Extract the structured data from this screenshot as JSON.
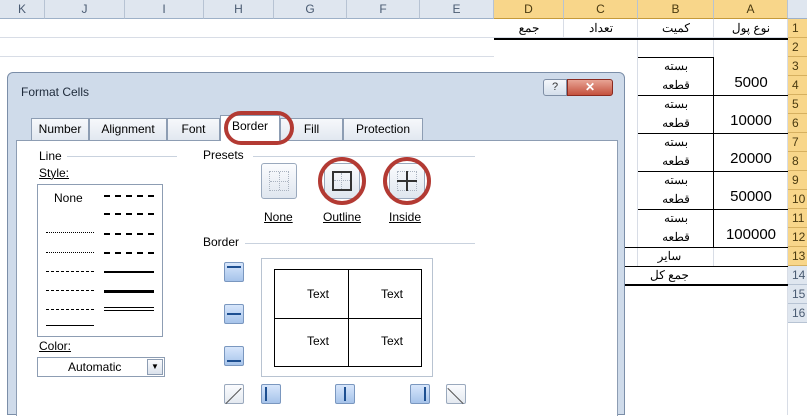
{
  "sheet": {
    "columns": [
      "K",
      "J",
      "I",
      "H",
      "G",
      "F",
      "E",
      "D",
      "C",
      "B",
      "A"
    ],
    "selected_columns": [
      "D",
      "C",
      "B",
      "A"
    ],
    "rows": [
      "1",
      "2",
      "3",
      "4",
      "5",
      "6",
      "7",
      "8",
      "9",
      "10",
      "11",
      "12",
      "13",
      "14",
      "15",
      "16"
    ],
    "selected_rows": [
      "1",
      "2",
      "3",
      "4",
      "5",
      "6",
      "7",
      "8",
      "9",
      "10",
      "11",
      "12",
      "13"
    ],
    "header_row": {
      "a": "نوع پول",
      "b": "کمیت",
      "c": "تعداد",
      "d": "جمع"
    },
    "denominations": [
      "5000",
      "10000",
      "20000",
      "50000",
      "100000"
    ],
    "qty_pack": "بسته",
    "qty_piece": "قطعه",
    "other_label": "سایر",
    "total_label": "جمع کل"
  },
  "dialog": {
    "title": "Format Cells",
    "help_label": "?",
    "close_label": "✕",
    "tabs": [
      "Number",
      "Alignment",
      "Font",
      "Border",
      "Fill",
      "Protection"
    ],
    "active_tab": "Border",
    "line": {
      "group_label": "Line",
      "style_label": "Style:",
      "none_label": "None",
      "color_label": "Color:",
      "color_value": "Automatic"
    },
    "presets": {
      "group_label": "Presets",
      "items": [
        "None",
        "Outline",
        "Inside"
      ],
      "highlighted": [
        "Outline",
        "Inside"
      ]
    },
    "border": {
      "group_label": "Border",
      "preview_text": [
        "Text",
        "Text",
        "Text",
        "Text"
      ]
    }
  },
  "colors": {
    "highlight_ring": "#b33a33",
    "selected_header": "#f8d68a",
    "dialog_frame": "#cfdbea"
  }
}
